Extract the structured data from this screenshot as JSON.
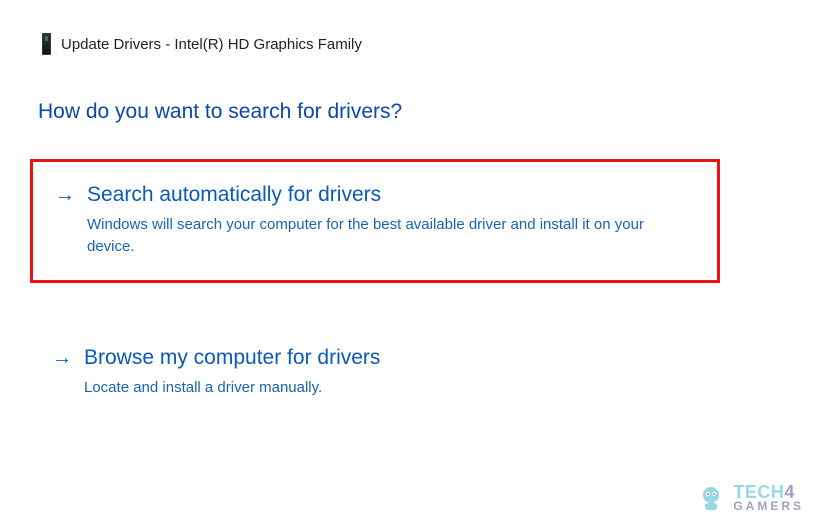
{
  "header": {
    "title": "Update Drivers - Intel(R) HD Graphics Family",
    "icon": "device-tower-icon"
  },
  "prompt": "How do you want to search for drivers?",
  "options": [
    {
      "title": "Search automatically for drivers",
      "description": "Windows will search your computer for the best available driver and install it on your device.",
      "highlighted": true
    },
    {
      "title": "Browse my computer for drivers",
      "description": "Locate and install a driver manually.",
      "highlighted": false
    }
  ],
  "watermark": {
    "tech": "TECH",
    "four": "4",
    "gamers": "GAMERS"
  },
  "colors": {
    "link": "#0a5ab8",
    "heading": "#0a4aa6",
    "highlight_border": "#e11"
  }
}
